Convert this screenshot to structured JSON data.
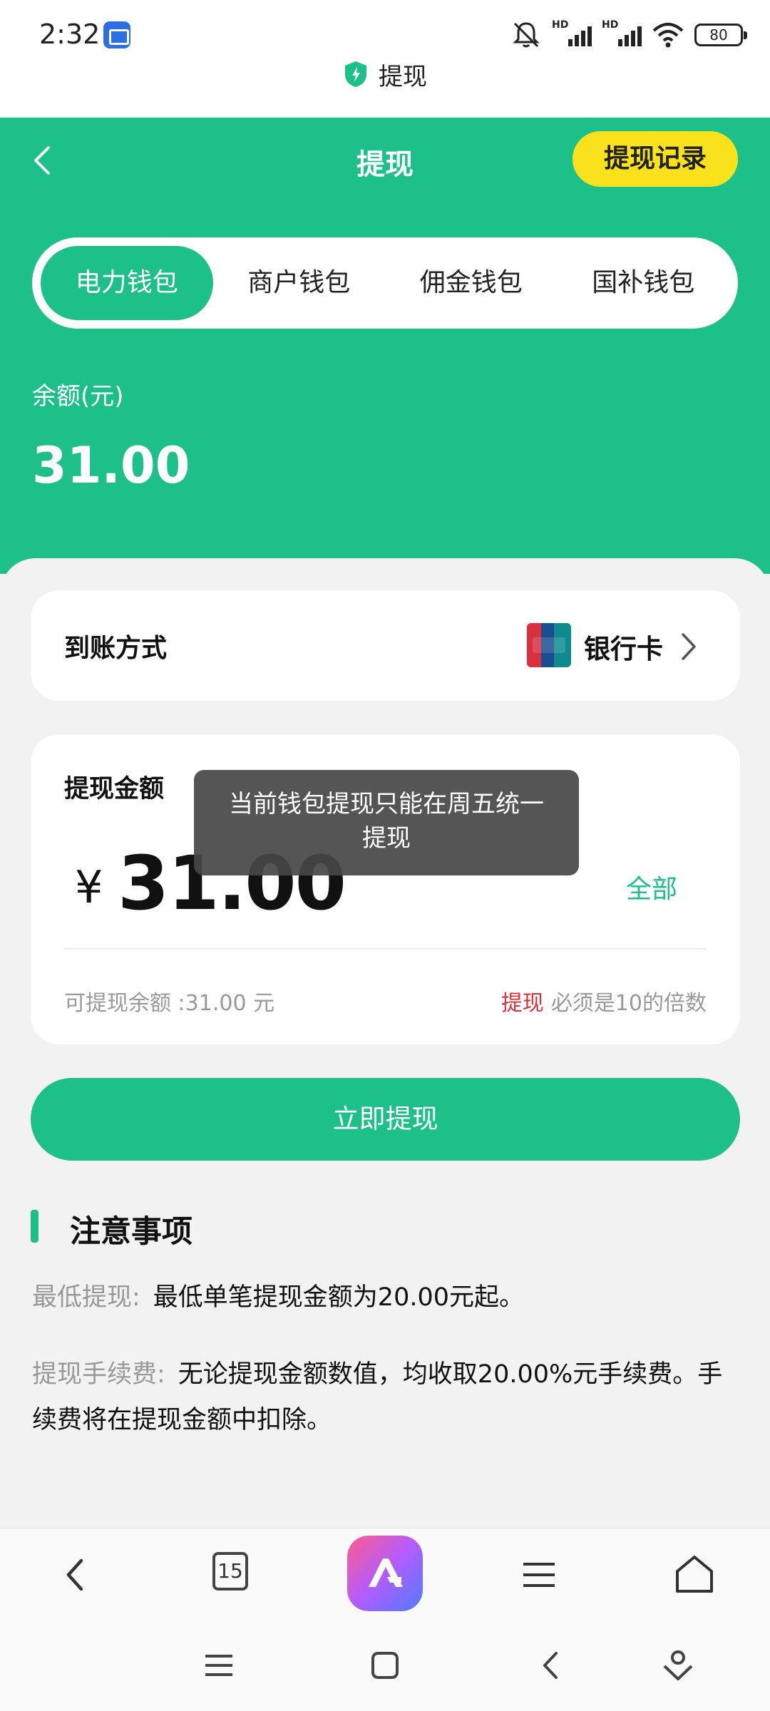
{
  "status_bar": {
    "time": "2:32",
    "signal1_label": "HD",
    "signal2_label": "HD",
    "battery": "80"
  },
  "browser": {
    "page_title": "提现",
    "tab_count": "15"
  },
  "header": {
    "title": "提现",
    "record_button": "提现记录"
  },
  "wallet_tabs": [
    {
      "label": "电力钱包",
      "active": true
    },
    {
      "label": "商户钱包",
      "active": false
    },
    {
      "label": "佣金钱包",
      "active": false
    },
    {
      "label": "国补钱包",
      "active": false
    }
  ],
  "balance": {
    "label": "余额(元)",
    "value": "31.00"
  },
  "method_card": {
    "label": "到账方式",
    "value": "银行卡"
  },
  "amount_card": {
    "label": "提现金额",
    "currency": "¥",
    "value": "31.00",
    "all_button": "全部",
    "available": "可提现余额 :31.00 元",
    "rule_highlight": "提现",
    "rule_text": "必须是10的倍数"
  },
  "toast": {
    "message": "当前钱包提现只能在周五统一提现"
  },
  "submit_button": "立即提现",
  "notes": {
    "title": "注意事项",
    "items": [
      {
        "key": "最低提现:",
        "text": "最低单笔提现金额为20.00元起。"
      },
      {
        "key": "提现手续费:",
        "text": "无论提现金额数值，均收取20.00%元手续费。手续费将在提现金额中扣除。"
      }
    ]
  },
  "colors": {
    "primary": "#1cc088",
    "accent_yellow": "#f9e21c",
    "warning_red": "#d8303c"
  }
}
